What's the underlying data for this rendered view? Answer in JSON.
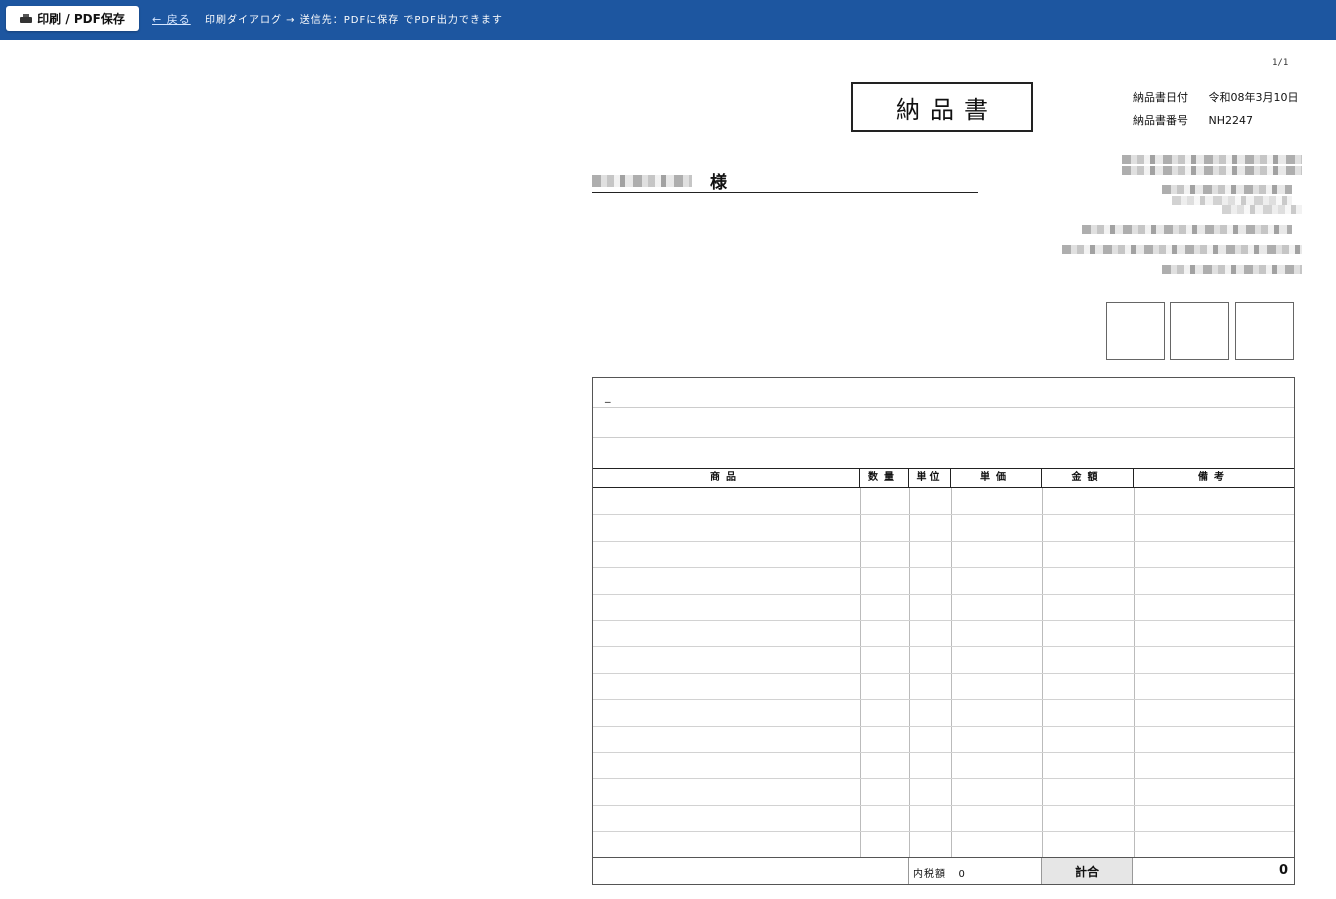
{
  "toolbar": {
    "print_button_label": "印刷 / PDF保存",
    "back_link_label": "← 戻る",
    "hint_text": "印刷ダイアログ → 送信先：PDFに保存 でPDF出力できます",
    "bg_color": "#1d56a0"
  },
  "document": {
    "page_indicator": "1/1",
    "title": "納品書",
    "date_label": "納品書日付",
    "date_value": "令和08年3月10日",
    "number_label": "納品書番号",
    "number_value": "NH2247",
    "customer_suffix": "様",
    "note_dash": "_",
    "table": {
      "headers": [
        "商品",
        "数量",
        "単位",
        "単価",
        "金額",
        "備考"
      ],
      "rows": [
        [
          "",
          "",
          "",
          "",
          "",
          ""
        ],
        [
          "",
          "",
          "",
          "",
          "",
          ""
        ],
        [
          "",
          "",
          "",
          "",
          "",
          ""
        ],
        [
          "",
          "",
          "",
          "",
          "",
          ""
        ],
        [
          "",
          "",
          "",
          "",
          "",
          ""
        ],
        [
          "",
          "",
          "",
          "",
          "",
          ""
        ],
        [
          "",
          "",
          "",
          "",
          "",
          ""
        ],
        [
          "",
          "",
          "",
          "",
          "",
          ""
        ],
        [
          "",
          "",
          "",
          "",
          "",
          ""
        ],
        [
          "",
          "",
          "",
          "",
          "",
          ""
        ],
        [
          "",
          "",
          "",
          "",
          "",
          ""
        ],
        [
          "",
          "",
          "",
          "",
          "",
          ""
        ],
        [
          "",
          "",
          "",
          "",
          "",
          ""
        ],
        [
          "",
          "",
          "",
          "",
          "",
          ""
        ]
      ]
    },
    "tax_label": "内税額",
    "tax_value": "0",
    "total_label": "計合",
    "total_value": "0"
  }
}
